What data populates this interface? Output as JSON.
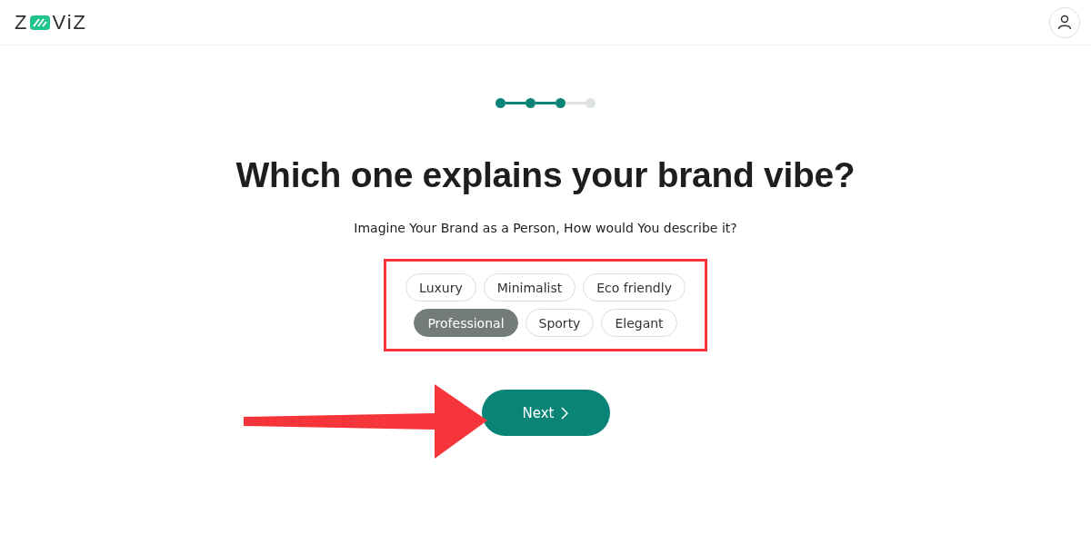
{
  "header": {
    "logo": {
      "before": "Z",
      "after": "ViZ"
    }
  },
  "stepper": [
    {
      "completed": true
    },
    {
      "completed": true
    },
    {
      "completed": true
    },
    {
      "completed": false
    }
  ],
  "title": "Which one explains your brand vibe?",
  "subtitle": "Imagine Your Brand as a Person, How would You describe it?",
  "option_rows": [
    [
      {
        "label": "Luxury",
        "selected": false
      },
      {
        "label": "Minimalist",
        "selected": false
      },
      {
        "label": "Eco friendly",
        "selected": false
      }
    ],
    [
      {
        "label": "Professional",
        "selected": true
      },
      {
        "label": "Sporty",
        "selected": false
      },
      {
        "label": "Elegant",
        "selected": false
      }
    ]
  ],
  "next_button": {
    "label": "Next"
  }
}
